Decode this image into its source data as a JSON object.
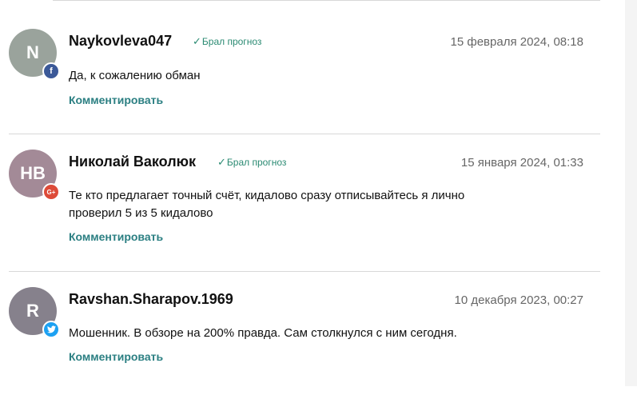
{
  "comments": [
    {
      "avatar_initials": "N",
      "avatar_color": "#9aa39c",
      "social": "facebook-icon",
      "social_glyph": "f",
      "author": "Naykovleva047",
      "verified_label": "Брал прогноз",
      "date": "15 февраля 2024, 08:18",
      "text": "Да, к сожалению обман",
      "reply_label": "Комментировать"
    },
    {
      "avatar_initials": "HB",
      "avatar_color": "#a38a97",
      "social": "google-plus-icon",
      "social_glyph": "G+",
      "author": "Николай Ваколюк",
      "verified_label": "Брал прогноз",
      "date": "15 января 2024, 01:33",
      "text": "Те кто предлагает точный счёт, кидалово сразу отписывайтесь я лично проверил 5 из 5 кидалово",
      "reply_label": "Комментировать"
    },
    {
      "avatar_initials": "R",
      "avatar_color": "#86818c",
      "social": "twitter-icon",
      "social_glyph": "",
      "author": "Ravshan.Sharapov.1969",
      "verified_label": "",
      "date": "10 декабря 2023, 00:27",
      "text": "Мошенник. В обзоре на 200% правда. Сам столкнулся с ним сегодня.",
      "reply_label": "Комментировать"
    }
  ],
  "verified_check_glyph": "✓"
}
